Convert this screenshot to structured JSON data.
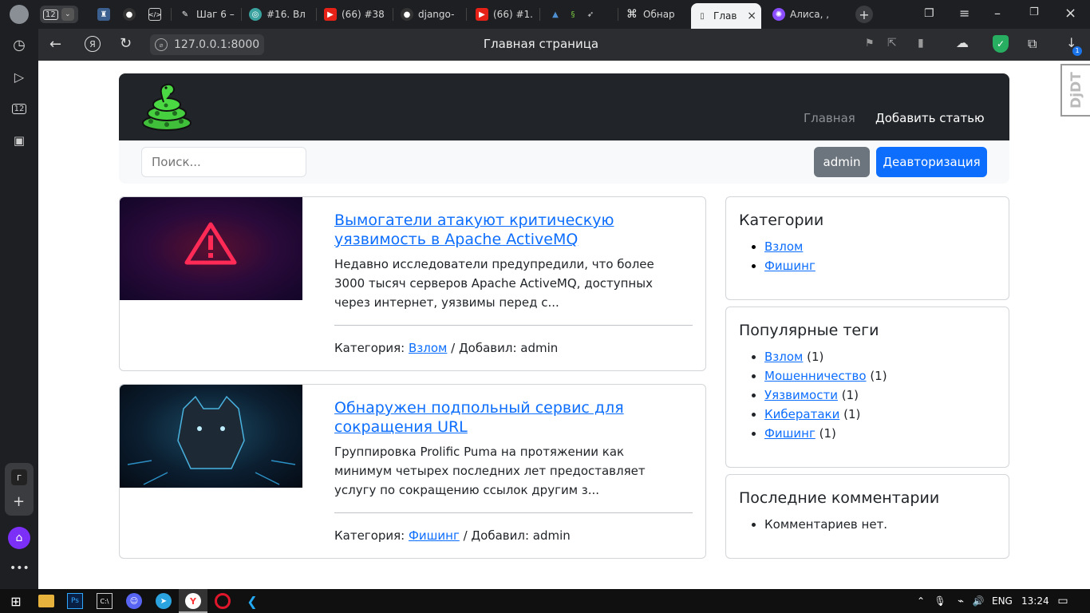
{
  "browser": {
    "tab_count": "12",
    "tabs": [
      {
        "label": "",
        "icon": "game-icon"
      },
      {
        "label": "",
        "icon": "github-icon"
      },
      {
        "label": "",
        "icon": "code-icon"
      },
      {
        "label": "Шаг 6 –",
        "icon": "stepik-icon"
      },
      {
        "label": "#16. Вл",
        "icon": "colab-icon"
      },
      {
        "label": "(66) #38",
        "icon": "youtube-icon"
      },
      {
        "label": "django-",
        "icon": "github-icon"
      },
      {
        "label": "(66) #1.",
        "icon": "youtube-icon"
      },
      {
        "label": "",
        "icon": "python-icon"
      },
      {
        "label": "Обнар",
        "icon": "habr-icon"
      },
      {
        "label": "Глав",
        "icon": "page-icon"
      },
      {
        "label": "Алиса, ,",
        "icon": "alice-icon"
      }
    ],
    "address": "127.0.0.1:8000",
    "page_title": "Главная страница",
    "downloads_badge": "1"
  },
  "sidebar": {
    "space_letter": "г"
  },
  "site": {
    "nav": {
      "home": "Главная",
      "add_article": "Добавить статью"
    },
    "search_placeholder": "Поиск...",
    "user_button": "admin",
    "logout_button": "Деавторизация",
    "djdt": "DjDT"
  },
  "articles": [
    {
      "title": "Вымогатели атакуют критическую уязвимость в Apache ActiveMQ",
      "excerpt": "Недавно исследователи предупредили, что более 3000 тысяч серверов Apache ActiveMQ, доступных через интернет, уязвимы перед с...",
      "category_label": "Категория:",
      "category": "Взлом",
      "added_by": "/ Добавил: admin"
    },
    {
      "title": "Обнаружен подпольный сервис для сокращения URL",
      "excerpt": "Группировка Prolific Puma на протяжении как минимум четырех последних лет предоставляет услугу по сокращению ссылок другим з...",
      "category_label": "Категория:",
      "category": "Фишинг",
      "added_by": "/ Добавил: admin"
    }
  ],
  "widgets": {
    "categories": {
      "title": "Категории",
      "items": [
        "Взлом",
        "Фишинг"
      ]
    },
    "tags": {
      "title": "Популярные теги",
      "items": [
        {
          "name": "Взлом",
          "count": "(1)"
        },
        {
          "name": "Мошенничество",
          "count": "(1)"
        },
        {
          "name": "Уязвимости",
          "count": "(1)"
        },
        {
          "name": "Кибератаки",
          "count": "(1)"
        },
        {
          "name": "Фишинг",
          "count": "(1)"
        }
      ]
    },
    "comments": {
      "title": "Последние комментарии",
      "empty": "Комментариев нет."
    }
  },
  "taskbar": {
    "lang": "ENG",
    "time": "13:24"
  },
  "colors": {
    "primary": "#0d6efd",
    "dark_nav": "#212529",
    "secondary": "#6c757d"
  }
}
